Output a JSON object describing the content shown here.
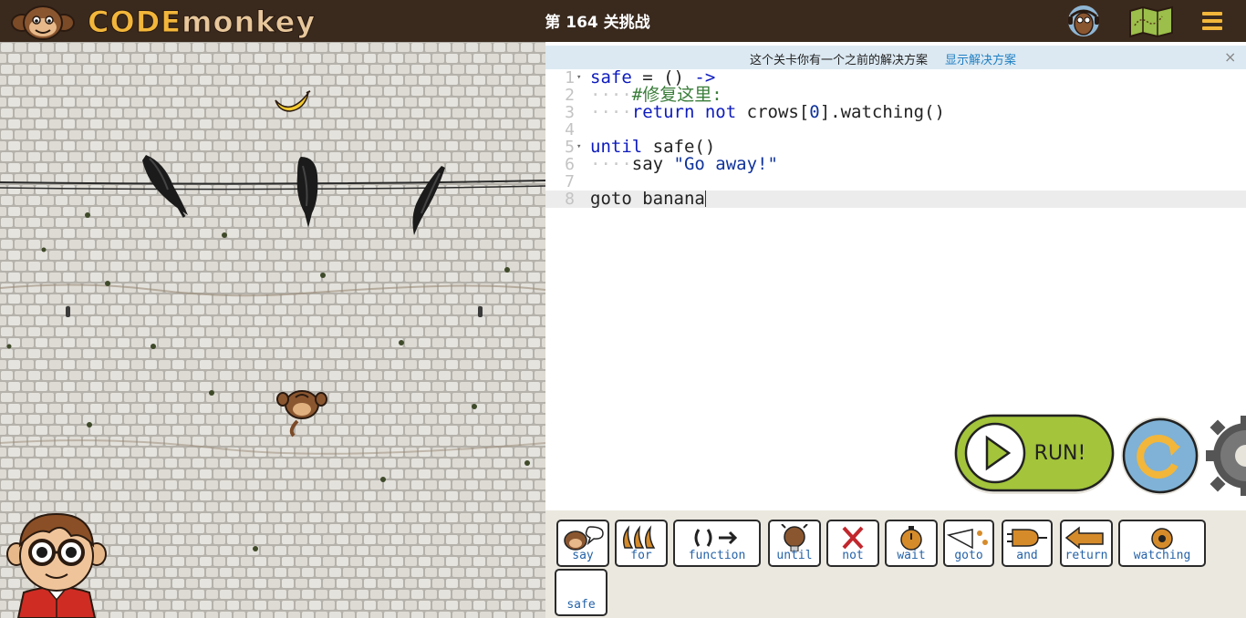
{
  "header": {
    "logo_text_1": "CODE",
    "logo_text_2": "monkey",
    "level_title": "第 164 关挑战",
    "icons": [
      "monkey-logo-icon",
      "player-avatar-icon",
      "map-icon",
      "menu-icon"
    ]
  },
  "notice": {
    "text": "这个关卡你有一个之前的解决方案",
    "link": "显示解决方案",
    "close": "×"
  },
  "editor": {
    "line_numbers": [
      "1",
      "2",
      "3",
      "4",
      "5",
      "6",
      "7",
      "8"
    ],
    "lines": [
      {
        "tokens": [
          {
            "t": "safe",
            "c": "kw"
          },
          {
            "t": " = () ",
            "c": ""
          },
          {
            "t": "->",
            "c": "kw"
          }
        ]
      },
      {
        "tokens": [
          {
            "t": "····",
            "c": "ind"
          },
          {
            "t": "#修复这里:",
            "c": "cm"
          }
        ]
      },
      {
        "tokens": [
          {
            "t": "····",
            "c": "ind"
          },
          {
            "t": "return",
            "c": "kw"
          },
          {
            "t": " ",
            "c": ""
          },
          {
            "t": "not",
            "c": "kw"
          },
          {
            "t": " crows[",
            "c": ""
          },
          {
            "t": "0",
            "c": "nm"
          },
          {
            "t": "].watching()",
            "c": ""
          }
        ]
      },
      {
        "tokens": []
      },
      {
        "tokens": [
          {
            "t": "until",
            "c": "kw"
          },
          {
            "t": " safe()",
            "c": ""
          }
        ]
      },
      {
        "tokens": [
          {
            "t": "····",
            "c": "ind"
          },
          {
            "t": "say ",
            "c": ""
          },
          {
            "t": "\"Go away!\"",
            "c": "st"
          }
        ]
      },
      {
        "tokens": []
      },
      {
        "tokens": [
          {
            "t": "goto banana",
            "c": ""
          }
        ]
      }
    ]
  },
  "controls": {
    "run_label": "RUN!"
  },
  "palette": {
    "snippets": [
      "say",
      "for",
      "function",
      "until",
      "not",
      "wait",
      "goto",
      "and",
      "return",
      "watching",
      "safe"
    ]
  },
  "colors": {
    "topbar": "#3a2a1e",
    "logo_gold": "#f2b63a",
    "run_green": "#a3c43b",
    "reset_blue": "#7fb2d6",
    "notice_bg": "#dce9f2",
    "keyword": "#0d1bbd",
    "comment": "#3a7d3a",
    "snippet_label": "#2563a8"
  }
}
